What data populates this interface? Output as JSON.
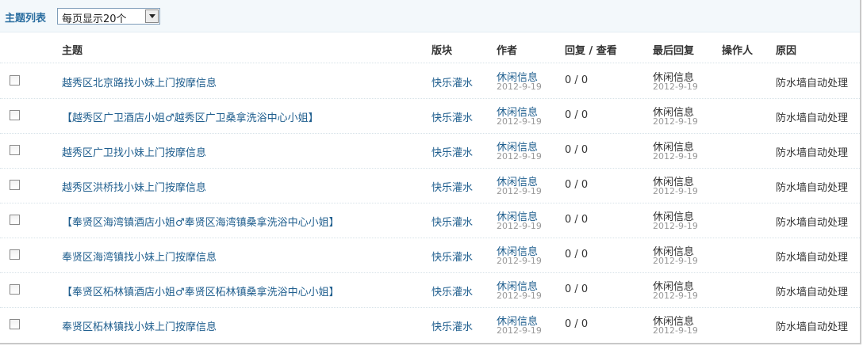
{
  "header": {
    "title": "主题列表",
    "per_page_select": "每页显示20个"
  },
  "columns": {
    "subject": "主题",
    "forum": "版块",
    "author": "作者",
    "replies_views": "回复 / 查看",
    "last_reply": "最后回复",
    "operator": "操作人",
    "reason": "原因"
  },
  "rows": [
    {
      "subject": "越秀区北京路找小妹上门按摩信息",
      "forum": "快乐灌水",
      "author": "休闲信息",
      "author_date": "2012-9-19",
      "replies_views": "0 / 0",
      "last_reply_user": "休闲信息",
      "last_reply_date": "2012-9-19",
      "operator": "",
      "reason": "防水墙自动处理"
    },
    {
      "subject": "【越秀区广卫酒店小姐♂越秀区广卫桑拿洗浴中心小姐】",
      "forum": "快乐灌水",
      "author": "休闲信息",
      "author_date": "2012-9-19",
      "replies_views": "0 / 0",
      "last_reply_user": "休闲信息",
      "last_reply_date": "2012-9-19",
      "operator": "",
      "reason": "防水墙自动处理"
    },
    {
      "subject": "越秀区广卫找小妹上门按摩信息",
      "forum": "快乐灌水",
      "author": "休闲信息",
      "author_date": "2012-9-19",
      "replies_views": "0 / 0",
      "last_reply_user": "休闲信息",
      "last_reply_date": "2012-9-19",
      "operator": "",
      "reason": "防水墙自动处理"
    },
    {
      "subject": "越秀区洪桥找小妹上门按摩信息",
      "forum": "快乐灌水",
      "author": "休闲信息",
      "author_date": "2012-9-19",
      "replies_views": "0 / 0",
      "last_reply_user": "休闲信息",
      "last_reply_date": "2012-9-19",
      "operator": "",
      "reason": "防水墙自动处理"
    },
    {
      "subject": "【奉贤区海湾镇酒店小姐♂奉贤区海湾镇桑拿洗浴中心小姐】",
      "forum": "快乐灌水",
      "author": "休闲信息",
      "author_date": "2012-9-19",
      "replies_views": "0 / 0",
      "last_reply_user": "休闲信息",
      "last_reply_date": "2012-9-19",
      "operator": "",
      "reason": "防水墙自动处理"
    },
    {
      "subject": "奉贤区海湾镇找小妹上门按摩信息",
      "forum": "快乐灌水",
      "author": "休闲信息",
      "author_date": "2012-9-19",
      "replies_views": "0 / 0",
      "last_reply_user": "休闲信息",
      "last_reply_date": "2012-9-19",
      "operator": "",
      "reason": "防水墙自动处理"
    },
    {
      "subject": "【奉贤区柘林镇酒店小姐♂奉贤区柘林镇桑拿洗浴中心小姐】",
      "forum": "快乐灌水",
      "author": "休闲信息",
      "author_date": "2012-9-19",
      "replies_views": "0 / 0",
      "last_reply_user": "休闲信息",
      "last_reply_date": "2012-9-19",
      "operator": "",
      "reason": "防水墙自动处理"
    },
    {
      "subject": "奉贤区柘林镇找小妹上门按摩信息",
      "forum": "快乐灌水",
      "author": "休闲信息",
      "author_date": "2012-9-19",
      "replies_views": "0 / 0",
      "last_reply_user": "休闲信息",
      "last_reply_date": "2012-9-19",
      "operator": "",
      "reason": "防水墙自动处理"
    }
  ]
}
